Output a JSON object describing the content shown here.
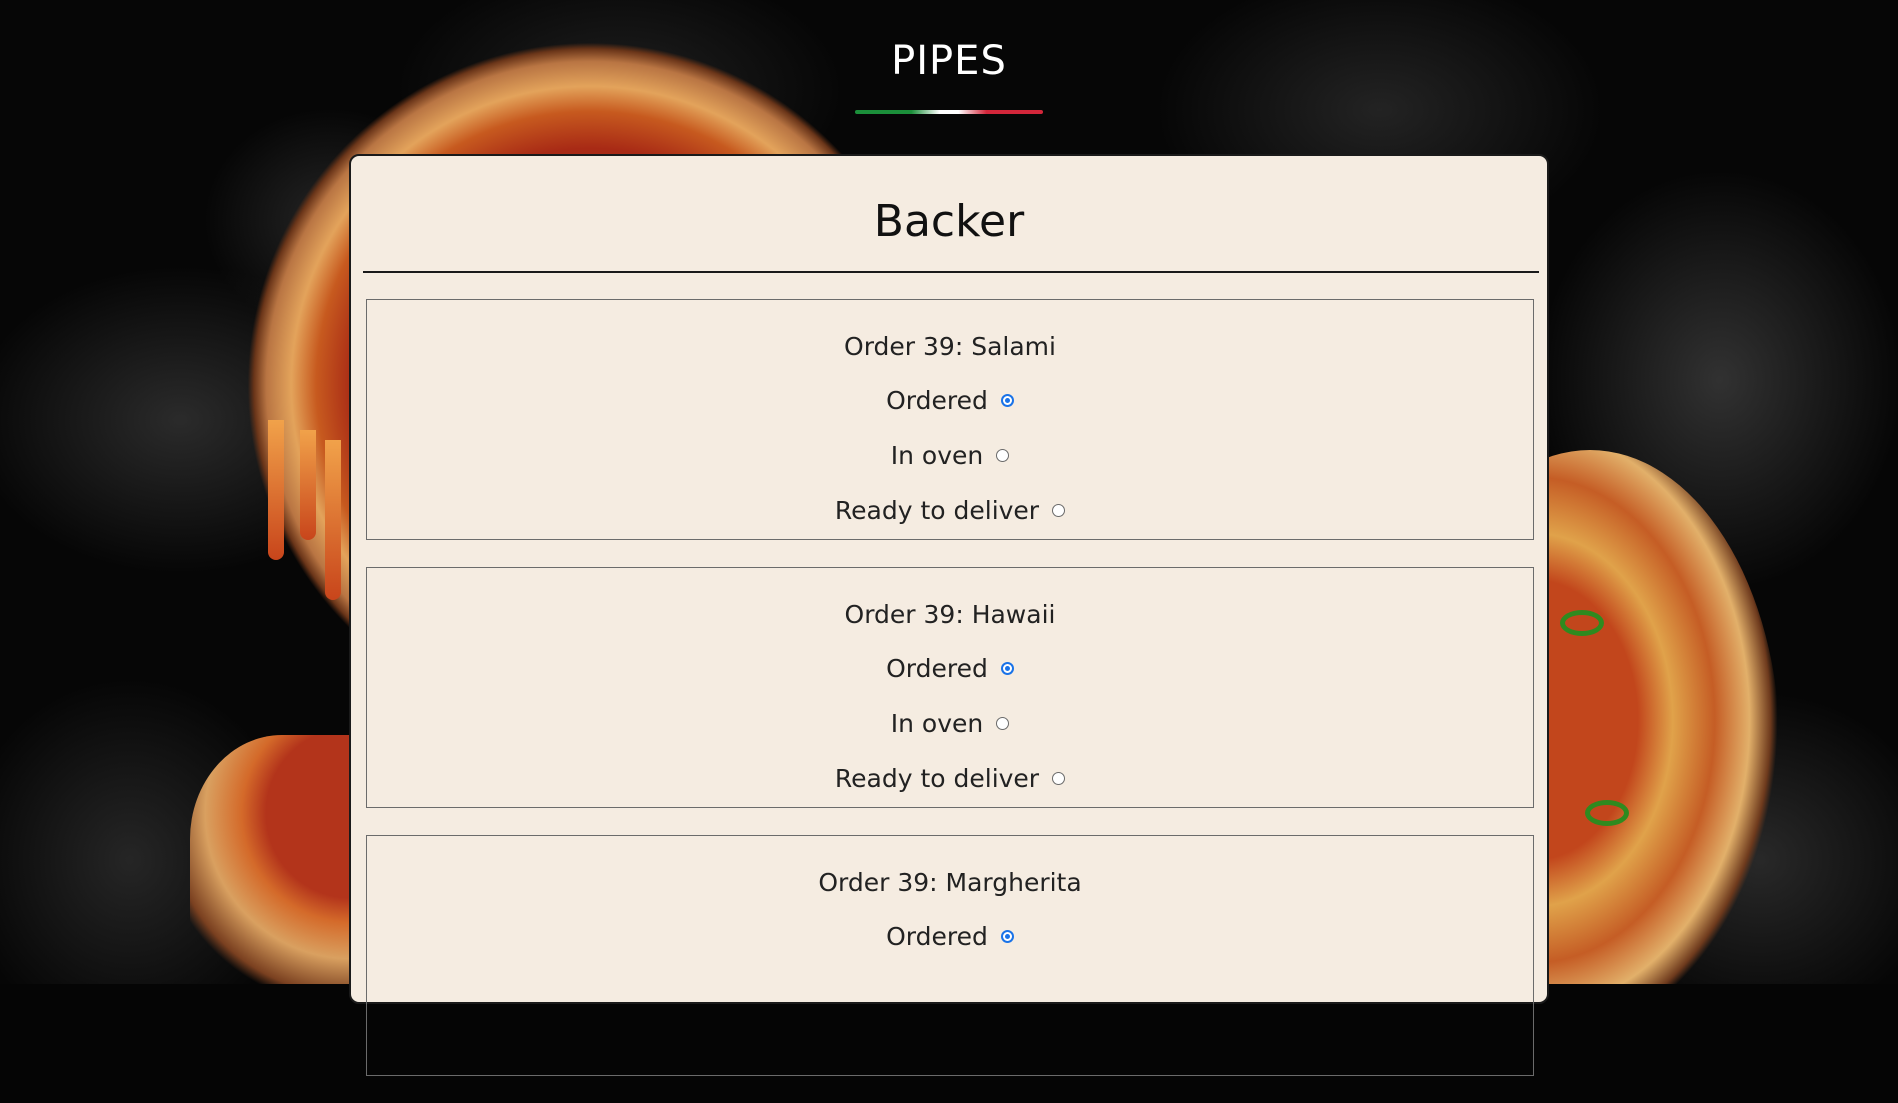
{
  "header": {
    "title": "PIPES"
  },
  "panel": {
    "title": "Backer"
  },
  "orders": [
    {
      "name": "Order 39: Salami",
      "options": [
        {
          "label": "Ordered",
          "checked": true
        },
        {
          "label": "In oven",
          "checked": false
        },
        {
          "label": "Ready to deliver",
          "checked": false
        }
      ]
    },
    {
      "name": "Order 39: Hawaii",
      "options": [
        {
          "label": "Ordered",
          "checked": true
        },
        {
          "label": "In oven",
          "checked": false
        },
        {
          "label": "Ready to deliver",
          "checked": false
        }
      ]
    },
    {
      "name": "Order 39: Margherita",
      "options": [
        {
          "label": "Ordered",
          "checked": true
        }
      ]
    }
  ],
  "colors": {
    "panel_bg": "#f5ece1",
    "radio_accent": "#1a73e8",
    "flag_green": "#1b8f3a",
    "flag_white": "#ffffff",
    "flag_red": "#d3263a"
  }
}
